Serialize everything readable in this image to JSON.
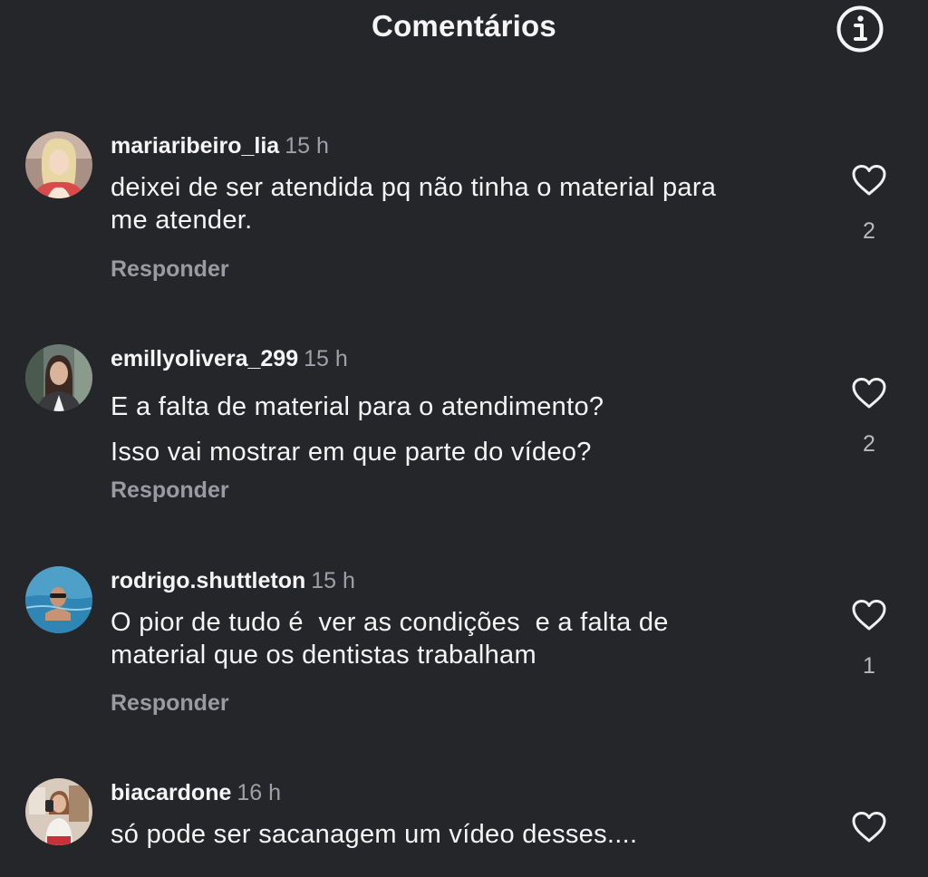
{
  "header": {
    "title": "Comentários",
    "info_icon": "info-circle-icon"
  },
  "comments": [
    {
      "username": "mariaribeiro_lia",
      "time": "15 h",
      "lines": [
        "deixei de ser atendida pq não tinha o material para",
        "me atender."
      ],
      "reply_label": "Responder",
      "likes": "2",
      "avatar_color": "#b79a8a"
    },
    {
      "username": "emillyolivera_299",
      "time": "15 h",
      "lines": [
        "E a falta de material para o atendimento?",
        "Isso vai mostrar em que parte do vídeo?"
      ],
      "reply_label": "Responder",
      "likes": "2",
      "avatar_color": "#5d6a5c"
    },
    {
      "username": "rodrigo.shuttleton",
      "time": "15 h",
      "lines": [
        "O pior de tudo é  ver as condições  e a falta de",
        "material que os dentistas trabalham"
      ],
      "reply_label": "Responder",
      "likes": "1",
      "avatar_color": "#5aa3c4"
    },
    {
      "username": "biacardone",
      "time": "16 h",
      "lines": [
        "só pode ser sacanagem um vídeo desses...."
      ],
      "avatar_color": "#c9b9a8"
    }
  ]
}
